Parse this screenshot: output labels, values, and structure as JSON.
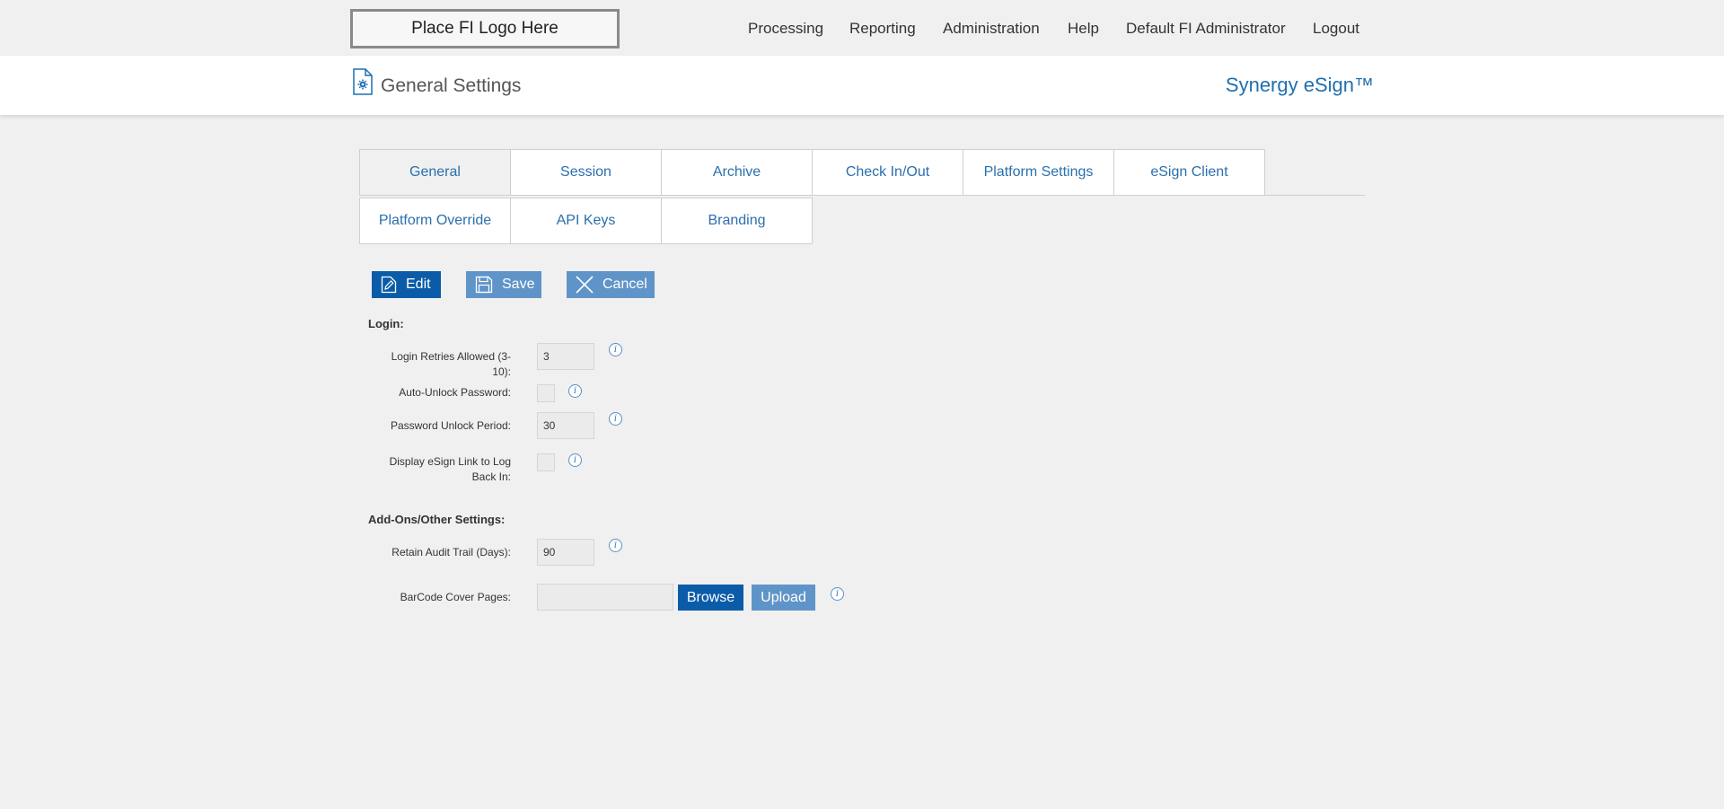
{
  "header": {
    "logo_text": "Place FI Logo Here",
    "nav": [
      "Processing",
      "Reporting",
      "Administration",
      "Help",
      "Default FI Administrator",
      "Logout"
    ]
  },
  "page": {
    "title": "General Settings",
    "brand": "Synergy eSign™"
  },
  "tabs": {
    "row1": [
      "General",
      "Session",
      "Archive",
      "Check In/Out",
      "Platform Settings",
      "eSign Client"
    ],
    "row2": [
      "Platform Override",
      "API Keys",
      "Branding"
    ],
    "active": "General"
  },
  "toolbar": {
    "edit_label": "Edit",
    "save_label": "Save",
    "cancel_label": "Cancel"
  },
  "login": {
    "section_title": "Login:",
    "retries_label": "Login Retries Allowed (3-10):",
    "retries_value": "3",
    "auto_unlock_label": "Auto-Unlock Password:",
    "auto_unlock_checked": false,
    "unlock_period_label": "Password Unlock Period:",
    "unlock_period_value": "30",
    "display_link_label": "Display eSign Link to Log Back In:",
    "display_link_checked": false
  },
  "addons": {
    "section_title": "Add-Ons/Other Settings:",
    "audit_label": "Retain Audit Trail (Days):",
    "audit_value": "90",
    "barcode_label": "BarCode Cover Pages:",
    "barcode_value": "",
    "browse_label": "Browse",
    "upload_label": "Upload"
  },
  "info_icon_glyph": "i",
  "colors": {
    "primary": "#0b5ca8",
    "secondary": "#5f94c8",
    "link": "#2b6fad",
    "background": "#f0f0f0"
  }
}
